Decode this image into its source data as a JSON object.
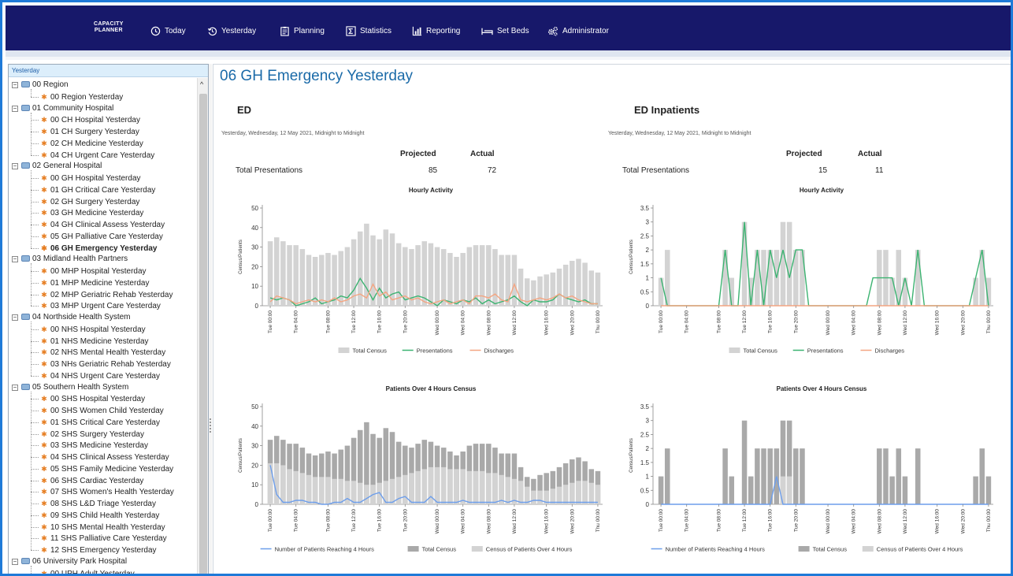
{
  "app": {
    "brand_line1": "CAPACITY",
    "brand_line2": "PLANNER"
  },
  "nav": [
    {
      "label": "Today",
      "icon": "clock-icon"
    },
    {
      "label": "Yesterday",
      "icon": "history-icon"
    },
    {
      "label": "Planning",
      "icon": "planning-icon"
    },
    {
      "label": "Statistics",
      "icon": "sigma-icon"
    },
    {
      "label": "Reporting",
      "icon": "bar-chart-icon"
    },
    {
      "label": "Set Beds",
      "icon": "bed-icon"
    },
    {
      "label": "Administrator",
      "icon": "gears-icon"
    }
  ],
  "sidebar": {
    "header": "Yesterday",
    "tree": [
      {
        "label": "00 Region",
        "level": 0
      },
      {
        "label": "00 Region Yesterday",
        "level": 1
      },
      {
        "label": "01 Community Hospital",
        "level": 0
      },
      {
        "label": "00 CH Hospital Yesterday",
        "level": 1
      },
      {
        "label": "01 CH Surgery Yesterday",
        "level": 1
      },
      {
        "label": "02 CH Medicine Yesterday",
        "level": 1
      },
      {
        "label": "04 CH Urgent Care Yesterday",
        "level": 1
      },
      {
        "label": "02 General Hospital",
        "level": 0
      },
      {
        "label": "00 GH Hospital Yesterday",
        "level": 1
      },
      {
        "label": "01 GH Critical Care Yesterday",
        "level": 1
      },
      {
        "label": "02 GH Surgery Yesterday",
        "level": 1
      },
      {
        "label": "03 GH Medicine Yesterday",
        "level": 1
      },
      {
        "label": "04 GH Clinical Assess Yesterday",
        "level": 1
      },
      {
        "label": "05 GH Palliative Care Yesterday",
        "level": 1
      },
      {
        "label": "06 GH Emergency Yesterday",
        "level": 1,
        "selected": true
      },
      {
        "label": "03 Midland Health Partners",
        "level": 0
      },
      {
        "label": "00 MHP Hospital Yesterday",
        "level": 1
      },
      {
        "label": "01 MHP Medicine Yesterday",
        "level": 1
      },
      {
        "label": "02 MHP Geriatric Rehab Yesterday",
        "level": 1
      },
      {
        "label": "03 MHP Urgent Care Yesterday",
        "level": 1
      },
      {
        "label": "04 Northside Health System",
        "level": 0
      },
      {
        "label": "00 NHS Hospital Yesterday",
        "level": 1
      },
      {
        "label": "01 NHS Medicine Yesterday",
        "level": 1
      },
      {
        "label": "02 NHS Mental Health Yesterday",
        "level": 1
      },
      {
        "label": "03 NHs Geriatric Rehab Yesterday",
        "level": 1
      },
      {
        "label": "04 NHS Urgent Care Yesterday",
        "level": 1
      },
      {
        "label": "05 Southern Health System",
        "level": 0
      },
      {
        "label": "00 SHS Hospital Yesterday",
        "level": 1
      },
      {
        "label": "00 SHS Women Child Yesterday",
        "level": 1
      },
      {
        "label": "01 SHS Critical Care Yesterday",
        "level": 1
      },
      {
        "label": "02 SHS Surgery Yesterday",
        "level": 1
      },
      {
        "label": "03 SHS Medicine Yesterday",
        "level": 1
      },
      {
        "label": "04 SHS Clinical Assess Yesterday",
        "level": 1
      },
      {
        "label": "05 SHS Family Medicine Yesterday",
        "level": 1
      },
      {
        "label": "06 SHS Cardiac Yesterday",
        "level": 1
      },
      {
        "label": "07 SHS Women's Health Yesterday",
        "level": 1
      },
      {
        "label": "08 SHS L&D Triage Yesterday",
        "level": 1
      },
      {
        "label": "09 SHS Child Health Yesterday",
        "level": 1
      },
      {
        "label": "10 SHS Mental Health Yesterday",
        "level": 1
      },
      {
        "label": "11 SHS Palliative Care Yesterday",
        "level": 1
      },
      {
        "label": "12 SHS Emergency Yesterday",
        "level": 1
      },
      {
        "label": "06 University Park Hospital",
        "level": 0
      },
      {
        "label": "00 UPH Adult Yesterday",
        "level": 1
      }
    ]
  },
  "main": {
    "title": "06 GH Emergency Yesterday",
    "panels": [
      {
        "title": "ED",
        "subtitle": "Yesterday, Wednesday, 12 May 2021, Midnight to Midnight",
        "col_projected": "Projected",
        "col_actual": "Actual",
        "row_label": "Total Presentations",
        "projected": "85",
        "actual": "72"
      },
      {
        "title": "ED Inpatients",
        "subtitle": "Yesterday, Wednesday, 12 May 2021, Midnight to Midnight",
        "col_projected": "Projected",
        "col_actual": "Actual",
        "row_label": "Total Presentations",
        "projected": "15",
        "actual": "11"
      }
    ]
  },
  "chart_data": [
    {
      "type": "bar",
      "title": "Hourly Activity",
      "ylabel": "Census/Patients",
      "ylim": [
        0,
        50
      ],
      "yticks": [
        "0",
        "10",
        "20",
        "30",
        "40",
        "50"
      ],
      "xticks": [
        "Tue 00:00",
        "Tue 04:00",
        "Tue 08:00",
        "Tue 12:00",
        "Tue 16:00",
        "Tue 20:00",
        "Wed 00:00",
        "Wed 04:00",
        "Wed 08:00",
        "Wed 12:00",
        "Wed 16:00",
        "Wed 20:00",
        "Thu 00:00"
      ],
      "legend_position": "bottom",
      "series": [
        {
          "name": "Total Census",
          "kind": "bar",
          "color": "#d3d3d3",
          "values": [
            33,
            35,
            33,
            31,
            31,
            29,
            26,
            25,
            26,
            27,
            26,
            28,
            30,
            34,
            38,
            42,
            36,
            34,
            39,
            37,
            32,
            30,
            29,
            31,
            33,
            32,
            30,
            29,
            27,
            25,
            27,
            30,
            31,
            31,
            31,
            29,
            26,
            26,
            26,
            19,
            14,
            13,
            15,
            16,
            17,
            19,
            21,
            23,
            24,
            22,
            18,
            17
          ]
        },
        {
          "name": "Presentations",
          "kind": "line",
          "color": "#3cb371",
          "values": [
            4,
            3,
            4,
            3,
            0,
            1,
            2,
            4,
            1,
            2,
            3,
            5,
            4,
            8,
            14,
            9,
            3,
            9,
            4,
            6,
            7,
            3,
            4,
            5,
            4,
            2,
            0,
            3,
            2,
            1,
            3,
            2,
            4,
            1,
            3,
            1,
            2,
            3,
            5,
            2,
            0,
            3,
            2,
            2,
            3,
            6,
            4,
            3,
            2,
            3,
            1,
            1
          ]
        },
        {
          "name": "Discharges",
          "kind": "line",
          "color": "#f4a582",
          "values": [
            2,
            5,
            4,
            3,
            1,
            2,
            3,
            2,
            3,
            2,
            4,
            2,
            3,
            5,
            6,
            4,
            11,
            5,
            7,
            3,
            4,
            5,
            3,
            4,
            2,
            1,
            2,
            3,
            1,
            2,
            3,
            1,
            5,
            5,
            4,
            6,
            3,
            2,
            11,
            3,
            2,
            3,
            4,
            3,
            4,
            6,
            4,
            5,
            3,
            2,
            1,
            1
          ]
        }
      ]
    },
    {
      "type": "bar",
      "title": "Hourly Activity",
      "ylabel": "Census/Patients",
      "ylim": [
        0,
        3.5
      ],
      "yticks": [
        "0",
        "0.5",
        "1",
        "1.5",
        "2",
        "2.5",
        "3",
        "3.5"
      ],
      "xticks": [
        "Tue 00:00",
        "Tue 04:00",
        "Tue 08:00",
        "Tue 12:00",
        "Tue 16:00",
        "Tue 20:00",
        "Wed 00:00",
        "Wed 04:00",
        "Wed 08:00",
        "Wed 12:00",
        "Wed 16:00",
        "Wed 20:00",
        "Thu 00:00"
      ],
      "legend_position": "bottom",
      "series": [
        {
          "name": "Total Census",
          "kind": "bar",
          "color": "#d3d3d3",
          "values": [
            1,
            2,
            0,
            0,
            0,
            0,
            0,
            0,
            0,
            0,
            2,
            1,
            0,
            3,
            1,
            2,
            2,
            2,
            2,
            3,
            3,
            2,
            2,
            0,
            0,
            0,
            0,
            0,
            0,
            0,
            0,
            0,
            0,
            0,
            2,
            2,
            1,
            2,
            1,
            0,
            2,
            0,
            0,
            0,
            0,
            0,
            0,
            0,
            0,
            1,
            2,
            1
          ]
        },
        {
          "name": "Presentations",
          "kind": "line",
          "color": "#3cb371",
          "values": [
            1,
            0,
            0,
            0,
            0,
            0,
            0,
            0,
            0,
            0,
            2,
            0,
            0,
            3,
            0,
            2,
            0,
            2,
            1,
            2,
            1,
            2,
            2,
            0,
            0,
            0,
            0,
            0,
            0,
            0,
            0,
            0,
            0,
            1,
            1,
            1,
            1,
            0,
            1,
            0,
            2,
            0,
            0,
            0,
            0,
            0,
            0,
            0,
            0,
            1,
            2,
            0
          ]
        },
        {
          "name": "Discharges",
          "kind": "line",
          "color": "#f4a582",
          "values": [
            0,
            0,
            0,
            0,
            0,
            0,
            0,
            0,
            0,
            0,
            0,
            0,
            0,
            0,
            0,
            0,
            0,
            0,
            0,
            0,
            0,
            0,
            0,
            0,
            0,
            0,
            0,
            0,
            0,
            0,
            0,
            0,
            0,
            0,
            0,
            0,
            0,
            0,
            0,
            0,
            0,
            0,
            0,
            0,
            0,
            0,
            0,
            0,
            0,
            0,
            0,
            0
          ]
        }
      ]
    },
    {
      "type": "bar",
      "title": "Patients Over 4 Hours Census",
      "ylabel": "Census/Patients",
      "ylim": [
        0,
        50
      ],
      "yticks": [
        "0",
        "10",
        "20",
        "30",
        "40",
        "50"
      ],
      "xticks": [
        "Tue 00:00",
        "Tue 04:00",
        "Tue 08:00",
        "Tue 12:00",
        "Tue 16:00",
        "Tue 20:00",
        "Wed 00:00",
        "Wed 04:00",
        "Wed 08:00",
        "Wed 12:00",
        "Wed 16:00",
        "Wed 20:00",
        "Thu 00:00"
      ],
      "legend_position": "bottom",
      "series": [
        {
          "name": "Number of Patients Reaching 4 Hours",
          "kind": "line",
          "color": "#6d9eeb",
          "values": [
            20,
            5,
            1,
            1,
            2,
            2,
            1,
            1,
            0,
            0,
            1,
            1,
            3,
            1,
            1,
            3,
            5,
            6,
            1,
            1,
            3,
            4,
            1,
            1,
            1,
            4,
            1,
            1,
            1,
            1,
            2,
            1,
            1,
            1,
            1,
            1,
            2,
            1,
            2,
            1,
            1,
            2,
            2,
            1,
            1,
            1,
            1,
            1,
            1,
            1,
            1,
            1
          ]
        },
        {
          "name": "Total Census",
          "kind": "bar",
          "color": "#a9a9a9",
          "values": [
            33,
            35,
            33,
            31,
            31,
            29,
            26,
            25,
            26,
            27,
            26,
            28,
            30,
            34,
            38,
            42,
            36,
            34,
            39,
            37,
            32,
            30,
            29,
            31,
            33,
            32,
            30,
            29,
            27,
            25,
            27,
            30,
            31,
            31,
            31,
            29,
            26,
            26,
            26,
            19,
            14,
            13,
            15,
            16,
            17,
            19,
            21,
            23,
            24,
            22,
            18,
            17
          ]
        },
        {
          "name": "Census of Patients Over 4 Hours",
          "kind": "bar",
          "color": "#d3d3d3",
          "values": [
            21,
            21,
            20,
            18,
            17,
            16,
            15,
            14,
            14,
            14,
            13,
            13,
            12,
            12,
            11,
            10,
            10,
            11,
            12,
            13,
            14,
            15,
            16,
            17,
            18,
            19,
            19,
            19,
            18,
            18,
            18,
            17,
            17,
            17,
            16,
            16,
            15,
            14,
            13,
            12,
            9,
            7,
            7,
            7,
            8,
            9,
            10,
            11,
            12,
            12,
            11,
            10
          ]
        }
      ]
    },
    {
      "type": "bar",
      "title": "Patients Over 4 Hours Census",
      "ylabel": "Census/Patients",
      "ylim": [
        0,
        3.5
      ],
      "yticks": [
        "0",
        "0.5",
        "1",
        "1.5",
        "2",
        "2.5",
        "3",
        "3.5"
      ],
      "xticks": [
        "Tue 00:00",
        "Tue 04:00",
        "Tue 08:00",
        "Tue 12:00",
        "Tue 16:00",
        "Tue 20:00",
        "Wed 00:00",
        "Wed 04:00",
        "Wed 08:00",
        "Wed 12:00",
        "Wed 16:00",
        "Wed 20:00",
        "Thu 00:00"
      ],
      "legend_position": "bottom",
      "series": [
        {
          "name": "Number of Patients Reaching 4 Hours",
          "kind": "line",
          "color": "#6d9eeb",
          "values": [
            0,
            0,
            0,
            0,
            0,
            0,
            0,
            0,
            0,
            0,
            0,
            0,
            0,
            0,
            0,
            0,
            0,
            0,
            1,
            0,
            0,
            0,
            0,
            0,
            0,
            0,
            0,
            0,
            0,
            0,
            0,
            0,
            0,
            0,
            0,
            0,
            0,
            0,
            0,
            0,
            0,
            0,
            0,
            0,
            0,
            0,
            0,
            0,
            0,
            0,
            0,
            0
          ]
        },
        {
          "name": "Total Census",
          "kind": "bar",
          "color": "#a9a9a9",
          "values": [
            1,
            2,
            0,
            0,
            0,
            0,
            0,
            0,
            0,
            0,
            2,
            1,
            0,
            3,
            1,
            2,
            2,
            2,
            2,
            3,
            3,
            2,
            2,
            0,
            0,
            0,
            0,
            0,
            0,
            0,
            0,
            0,
            0,
            0,
            2,
            2,
            1,
            2,
            1,
            0,
            2,
            0,
            0,
            0,
            0,
            0,
            0,
            0,
            0,
            1,
            2,
            1
          ]
        },
        {
          "name": "Census of Patients Over 4 Hours",
          "kind": "bar",
          "color": "#d3d3d3",
          "values": [
            0,
            0,
            0,
            0,
            0,
            0,
            0,
            0,
            0,
            0,
            0,
            0,
            0,
            0,
            0,
            0,
            0,
            0,
            0,
            1,
            1,
            0,
            0,
            0,
            0,
            0,
            0,
            0,
            0,
            0,
            0,
            0,
            0,
            0,
            0,
            0,
            0,
            0,
            0,
            0,
            0,
            0,
            0,
            0,
            0,
            0,
            0,
            0,
            0,
            0,
            0,
            0
          ]
        }
      ]
    }
  ]
}
